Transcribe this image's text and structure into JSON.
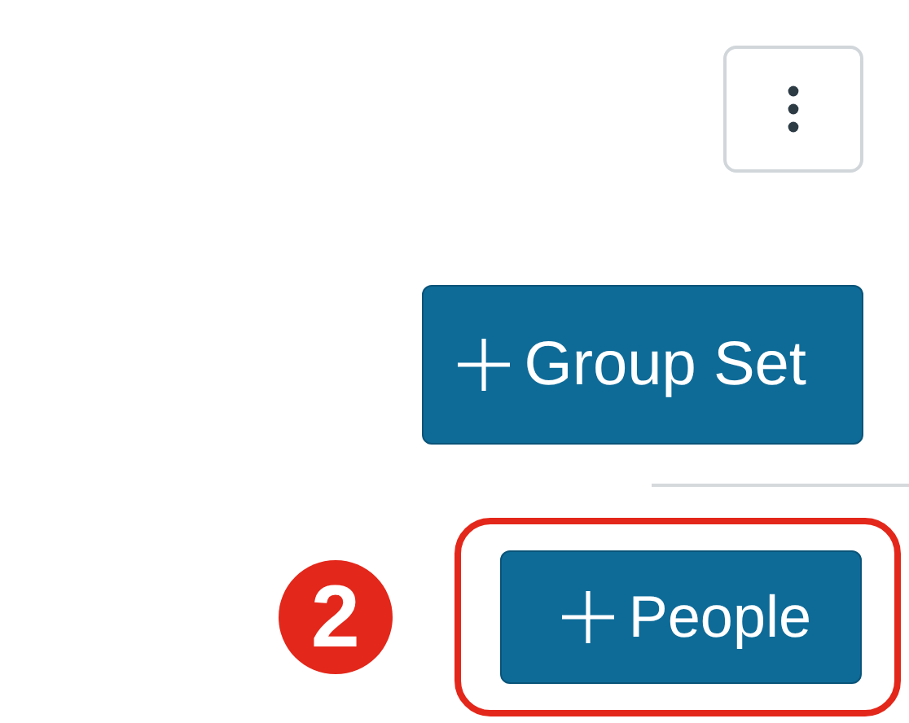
{
  "toolbar": {
    "buttons": [
      {
        "kind": "add",
        "label": "Group Set",
        "highlighted": false
      },
      {
        "kind": "add",
        "label": "People",
        "highlighted": true,
        "step": "2"
      }
    ]
  }
}
